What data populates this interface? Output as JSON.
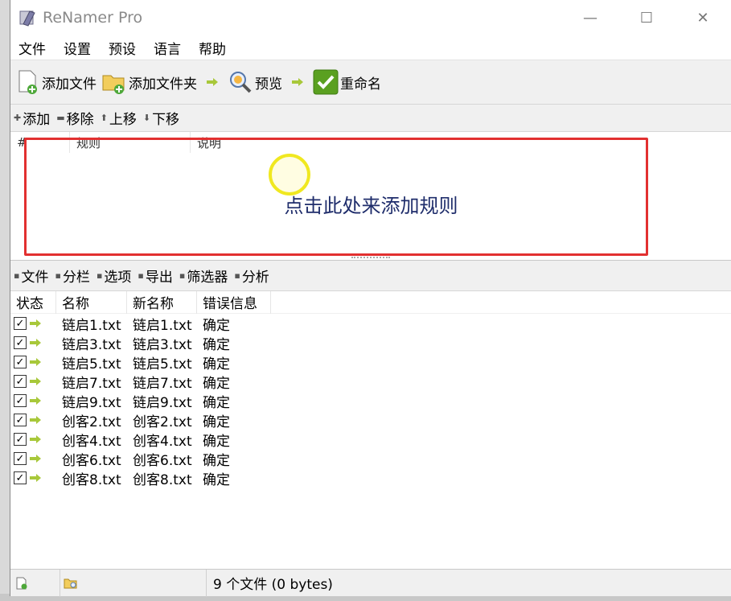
{
  "window": {
    "title": "ReNamer Pro",
    "controls": {
      "minimize": "—",
      "maximize": "☐",
      "close": "✕"
    }
  },
  "menu": [
    "文件",
    "设置",
    "预设",
    "语言",
    "帮助"
  ],
  "toolbar": {
    "add_files": "添加文件",
    "add_folder": "添加文件夹",
    "preview": "预览",
    "rename": "重命名"
  },
  "rules_toolbar": {
    "add": "添加",
    "remove": "移除",
    "move_up": "上移",
    "move_down": "下移"
  },
  "rules_table": {
    "columns": [
      "#",
      "规则",
      "说明"
    ],
    "empty_hint": "点击此处来添加规则"
  },
  "files_toolbar": {
    "files": "文件",
    "columns": "分栏",
    "options": "选项",
    "export": "导出",
    "filters": "筛选器",
    "analyze": "分析"
  },
  "files_table": {
    "columns": [
      "状态",
      "名称",
      "新名称",
      "错误信息"
    ],
    "rows": [
      {
        "name": "链启1.txt",
        "new_name": "链启1.txt",
        "error": "确定"
      },
      {
        "name": "链启3.txt",
        "new_name": "链启3.txt",
        "error": "确定"
      },
      {
        "name": "链启5.txt",
        "new_name": "链启5.txt",
        "error": "确定"
      },
      {
        "name": "链启7.txt",
        "new_name": "链启7.txt",
        "error": "确定"
      },
      {
        "name": "链启9.txt",
        "new_name": "链启9.txt",
        "error": "确定"
      },
      {
        "name": "创客2.txt",
        "new_name": "创客2.txt",
        "error": "确定"
      },
      {
        "name": "创客4.txt",
        "new_name": "创客4.txt",
        "error": "确定"
      },
      {
        "name": "创客6.txt",
        "new_name": "创客6.txt",
        "error": "确定"
      },
      {
        "name": "创客8.txt",
        "new_name": "创客8.txt",
        "error": "确定"
      }
    ]
  },
  "statusbar": {
    "summary": "9 个文件 (0 bytes)"
  },
  "colors": {
    "highlight_border": "#e23030",
    "click_marker": "#f0e820",
    "hint_text": "#1f2d6b",
    "check_green": "#5aa020"
  }
}
